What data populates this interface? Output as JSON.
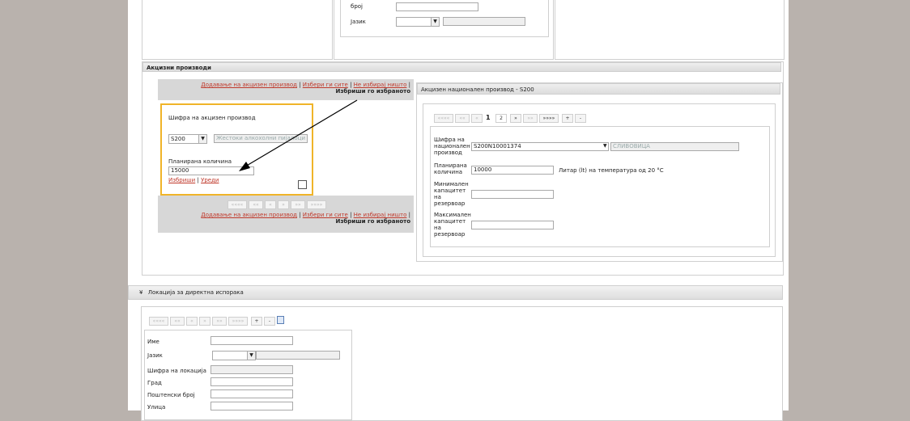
{
  "top_form": {
    "broj_label": "број",
    "jazik_label": "Јазик"
  },
  "excise": {
    "section_title": "Акцизни производи",
    "actions_top": {
      "add": "Додавање на акцизен производ",
      "select_all": "Избери ги сите",
      "select_none": "Не избирај ништо",
      "delete_selected": "Избриши го избраното",
      "sep": "|"
    },
    "card": {
      "code_label": "Шифра на акцизен производ",
      "code_value": "S200",
      "code_desc": "Жестоки алкохолни пијалоци",
      "qty_label": "Планирана количина",
      "qty_value": "15000",
      "delete_link": "Избриши",
      "edit_link": "Уреди",
      "sep": "|"
    },
    "pager_bottom": [
      "«««« ",
      "«« ",
      "« ",
      "» ",
      "»» ",
      "»»»» "
    ],
    "actions_bottom": {
      "add": "Додавање на акцизен производ",
      "select_all": "Избери ги сите",
      "select_none": "Не избирај ништо",
      "delete_selected": "Избриши го избраното",
      "sep": "|"
    }
  },
  "national": {
    "title": "Акцизен национален производ - S200",
    "pager": {
      "first": "««««",
      "prev2": "««",
      "prev": "«",
      "page1": "1",
      "page2": "2",
      "next": "»",
      "next2": "»»",
      "last": "»»»»",
      "add": "+",
      "remove": "-"
    },
    "code_label": "Шифра на национален производ",
    "code_value": "S200N10001374",
    "code_desc": "СЛИВОВИЦА",
    "qty_label": "Планирана количина",
    "qty_value": "10000",
    "qty_unit": "Литар (lt) на температура од 20 °C",
    "min_label": "Минимален капацитет на резервоар",
    "max_label": "Максимален капацитет на резервоар"
  },
  "location": {
    "section_title": "Локација за директна испорака",
    "toggle_glyph": "¥",
    "pager": {
      "first": "««««",
      "prev2": "««",
      "prev": "«",
      "next": "»",
      "next2": "»»",
      "last": "»»»»",
      "add": "+",
      "remove": "-"
    },
    "name_label": "Име",
    "lang_label": "Јазик",
    "code_label": "Шифра на локација",
    "city_label": "Град",
    "postal_label": "Поштенски број",
    "street_label": "Улица"
  }
}
